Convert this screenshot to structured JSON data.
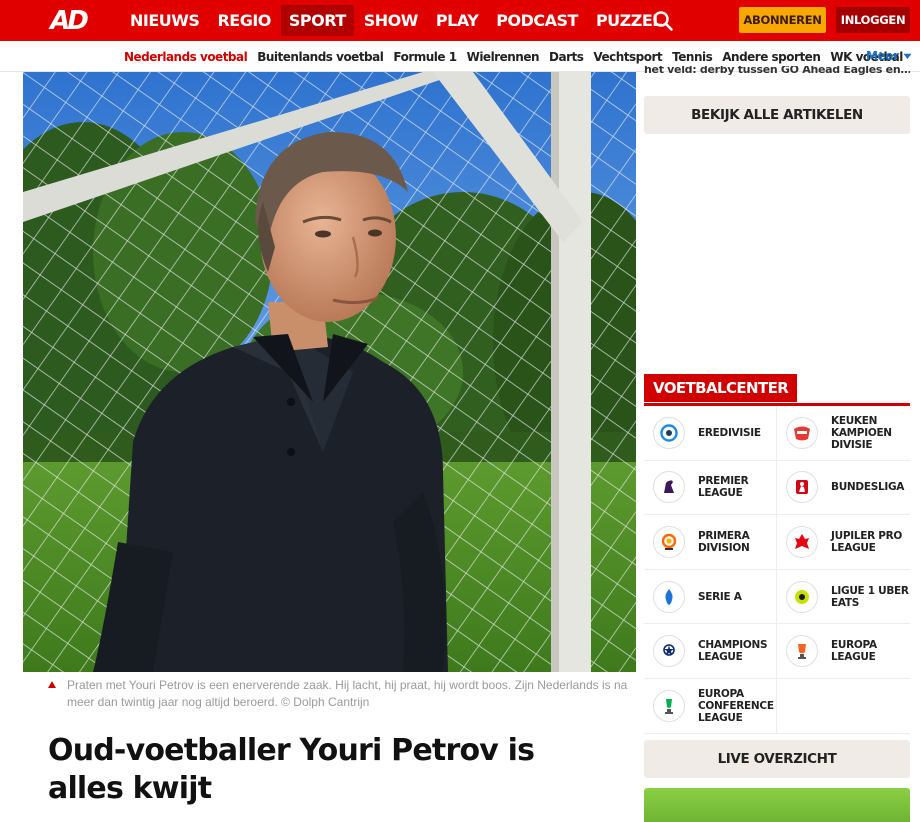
{
  "brand": {
    "logo": "AD"
  },
  "nav": {
    "items": [
      {
        "label": "NIEUWS",
        "active": false
      },
      {
        "label": "REGIO",
        "active": false
      },
      {
        "label": "SPORT",
        "active": true
      },
      {
        "label": "SHOW",
        "active": false
      },
      {
        "label": "PLAY",
        "active": false
      },
      {
        "label": "PODCAST",
        "active": false
      },
      {
        "label": "PUZZEL",
        "active": false
      }
    ],
    "search_icon": "search-icon",
    "subscribe_label": "ABONNEREN",
    "login_label": "INLOGGEN"
  },
  "subnav": {
    "items": [
      {
        "label": "Nederlands voetbal",
        "active": true
      },
      {
        "label": "Buitenlands voetbal",
        "active": false
      },
      {
        "label": "Formule 1",
        "active": false
      },
      {
        "label": "Wielrennen",
        "active": false
      },
      {
        "label": "Darts",
        "active": false
      },
      {
        "label": "Vechtsport",
        "active": false
      },
      {
        "label": "Tennis",
        "active": false
      },
      {
        "label": "Andere sporten",
        "active": false
      },
      {
        "label": "WK voetbal",
        "active": false
      }
    ],
    "more_label": "Meer"
  },
  "article": {
    "caption": "Praten met Youri Petrov is een enerverende zaak. Hij lacht, hij praat, hij wordt boos. Zijn Nederlands is na meer dan twintig jaar nog altijd beroerd. © Dolph Cantrijn",
    "headline": "Oud-voetballer Youri Petrov is alles kwijt"
  },
  "sidebar": {
    "snippet": "het veld: derby tussen GO Ahead Eagles en…",
    "all_articles_label": "BEKIJK ALLE ARTIKELEN",
    "voetbalcenter": {
      "title": "VOETBALCENTER",
      "leagues": [
        {
          "label": "Eredivisie",
          "icon": "eredivisie-logo-icon",
          "color": "#1e88e5"
        },
        {
          "label": "Keuken Kampioen Divisie",
          "icon": "kkd-logo-icon",
          "color": "#e53935"
        },
        {
          "label": "Premier League",
          "icon": "premier-league-logo-icon",
          "color": "#3d195b"
        },
        {
          "label": "Bundesliga",
          "icon": "bundesliga-logo-icon",
          "color": "#d20515"
        },
        {
          "label": "Primera Division",
          "icon": "laliga-logo-icon",
          "color": "#ff6a00"
        },
        {
          "label": "Jupiler Pro League",
          "icon": "jupiler-logo-icon",
          "color": "#e30613"
        },
        {
          "label": "Serie A",
          "icon": "serie-a-logo-icon",
          "color": "#1d74d8"
        },
        {
          "label": "Ligue 1 Uber Eats",
          "icon": "ligue1-logo-icon",
          "color": "#c8e000"
        },
        {
          "label": "Champions League",
          "icon": "champions-league-logo-icon",
          "color": "#0b2a6f"
        },
        {
          "label": "Europa League",
          "icon": "europa-league-logo-icon",
          "color": "#f26522"
        },
        {
          "label": "Europa Conference League",
          "icon": "conference-league-logo-icon",
          "color": "#00b050"
        }
      ]
    },
    "live_label": "LIVE OVERZICHT"
  },
  "colors": {
    "brand_red": "#e00000",
    "accent_yellow": "#f6a800",
    "button_beige": "#f0ebe6"
  }
}
